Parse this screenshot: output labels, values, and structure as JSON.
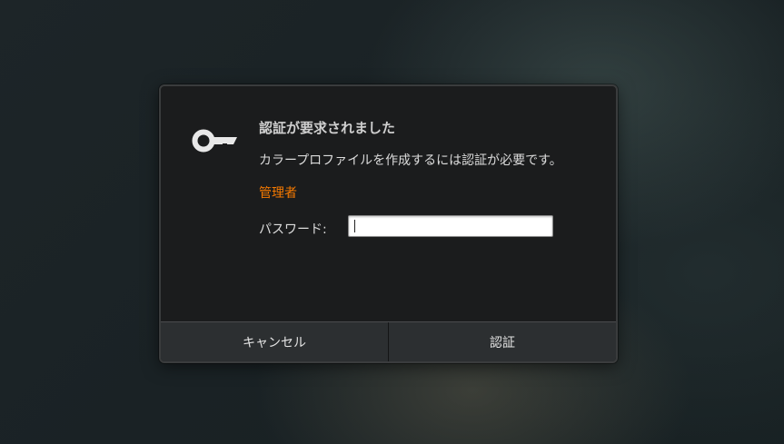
{
  "dialog": {
    "icon": "key-icon",
    "title": "認証が要求されました",
    "message": "カラープロファイルを作成するには認証が必要です。",
    "user": "管理者",
    "password_label": "パスワード:",
    "password_value": "",
    "cancel_label": "キャンセル",
    "authenticate_label": "認証"
  },
  "colors": {
    "user_accent": "#f57900",
    "dialog_bg": "#1b1c1d",
    "button_bg": "#2c2f31"
  }
}
